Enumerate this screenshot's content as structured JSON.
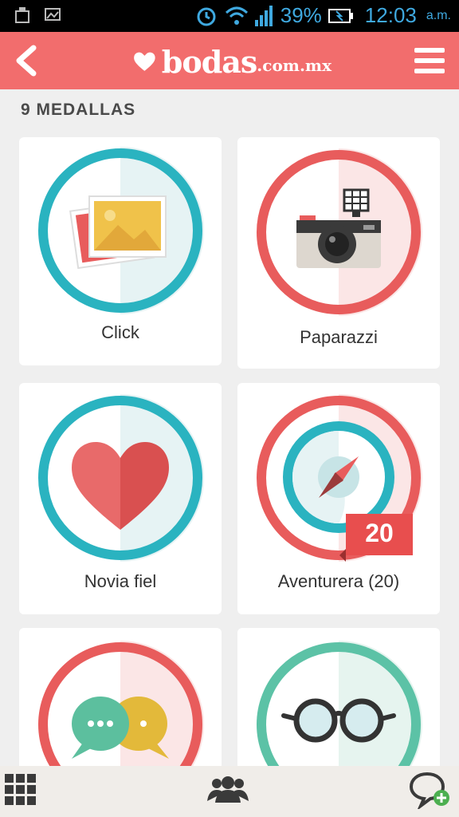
{
  "status_bar": {
    "battery_percent": "39%",
    "time": "12:03",
    "ampm": "a.m."
  },
  "header": {
    "logo_brand": "bodas",
    "logo_domain": ".com.mx",
    "back_icon": "chevron-left-icon",
    "menu_icon": "hamburger-menu-icon"
  },
  "section": {
    "title": "9 MEDALLAS"
  },
  "medals": [
    {
      "label": "Click",
      "icon": "photos-icon",
      "ring_color": "#2ab3c0"
    },
    {
      "label": "Paparazzi",
      "icon": "camera-icon",
      "ring_color": "#e85c5c"
    },
    {
      "label": "Novia fiel",
      "icon": "heart-icon",
      "ring_color": "#2ab3c0"
    },
    {
      "label": "Aventurera (20)",
      "icon": "compass-icon",
      "ring_color": "#e85c5c",
      "badge": "20"
    },
    {
      "label": "",
      "icon": "chat-bubbles-icon",
      "ring_color": "#e85c5c"
    },
    {
      "label": "",
      "icon": "glasses-icon",
      "ring_color": "#5cc2a6"
    }
  ],
  "bottom_nav": {
    "grid_icon": "grid-icon",
    "community_icon": "people-icon",
    "new_chat_icon": "chat-add-icon"
  },
  "colors": {
    "brand": "#f26d6d",
    "teal": "#2ab3c0",
    "red": "#e85c5c",
    "green": "#5cc2a6"
  }
}
